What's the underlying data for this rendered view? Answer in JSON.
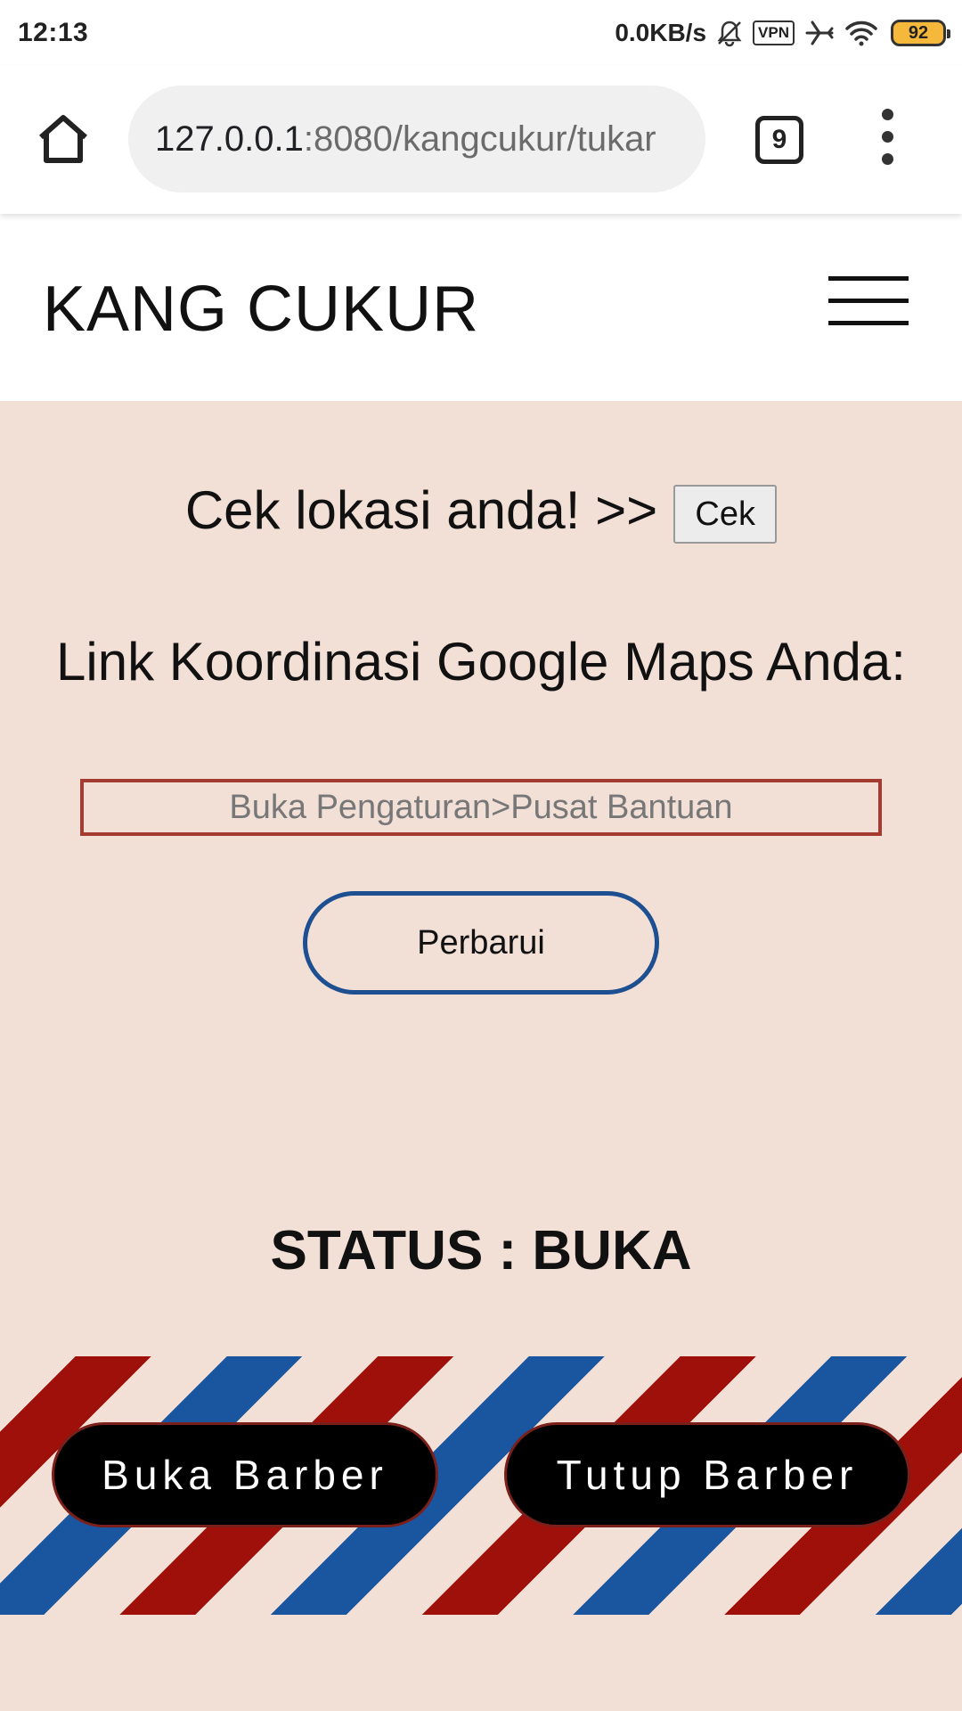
{
  "status_bar": {
    "time": "12:13",
    "net_speed": "0.0KB/s",
    "vpn_label": "VPN",
    "battery": "92"
  },
  "browser": {
    "url_host": "127.0.0.1",
    "url_path": ":8080/kangcukur/tukar",
    "tab_count": "9"
  },
  "header": {
    "brand": "KANG CUKUR"
  },
  "main": {
    "check_text": "Cek lokasi anda! >>",
    "check_button": "Cek",
    "maps_title": "Link Koordinasi Google Maps Anda:",
    "coord_placeholder": "Buka Pengaturan>Pusat Bantuan",
    "update_button": "Perbarui",
    "status": "STATUS : BUKA"
  },
  "actions": {
    "open_label": "Buka Barber",
    "close_label": "Tutup Barber"
  },
  "colors": {
    "page_bg": "#f2dfd6",
    "pole_red": "#a0100a",
    "pole_blue": "#1a55a0",
    "input_border": "#a33b30",
    "update_border": "#1d4f91"
  }
}
